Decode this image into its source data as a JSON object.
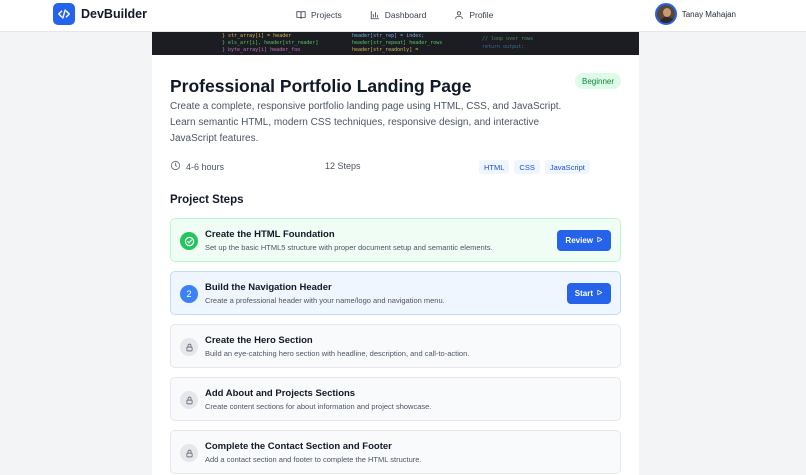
{
  "header": {
    "brand": "DevBuilder",
    "nav": [
      {
        "label": "Projects",
        "icon": "book-icon"
      },
      {
        "label": "Dashboard",
        "icon": "bar-chart-icon"
      },
      {
        "label": "Profile",
        "icon": "user-icon"
      }
    ],
    "user_name": "Tanay Mahajan"
  },
  "project": {
    "title": "Professional Portfolio Landing Page",
    "level": "Beginner",
    "description": "Create a complete, responsive portfolio landing page using HTML, CSS, and JavaScript. Learn semantic HTML, modern CSS techniques, responsive design, and interactive JavaScript features.",
    "duration": "4-6 hours",
    "steps_count": "12 Steps",
    "tags": [
      "HTML",
      "CSS",
      "JavaScript"
    ]
  },
  "steps_section": {
    "title": "Project Steps",
    "steps": [
      {
        "status": "done",
        "title": "Create the HTML Foundation",
        "description": "Set up the basic HTML5 structure with proper document setup and semantic elements.",
        "button": "Review"
      },
      {
        "status": "active",
        "number": "2",
        "title": "Build the Navigation Header",
        "description": "Create a professional header with your name/logo and navigation menu.",
        "button": "Start"
      },
      {
        "status": "locked",
        "title": "Create the Hero Section",
        "description": "Build an eye-catching hero section with headline, description, and call-to-action."
      },
      {
        "status": "locked",
        "title": "Add About and Projects Sections",
        "description": "Create content sections for about information and project showcase."
      },
      {
        "status": "locked",
        "title": "Complete the Contact Section and Footer",
        "description": "Add a contact section and footer to complete the HTML structure."
      }
    ]
  },
  "colors": {
    "accent": "#2563eb",
    "success": "#22c55e",
    "beginner_badge_bg": "#dcfce7",
    "beginner_badge_text": "#15803d"
  }
}
